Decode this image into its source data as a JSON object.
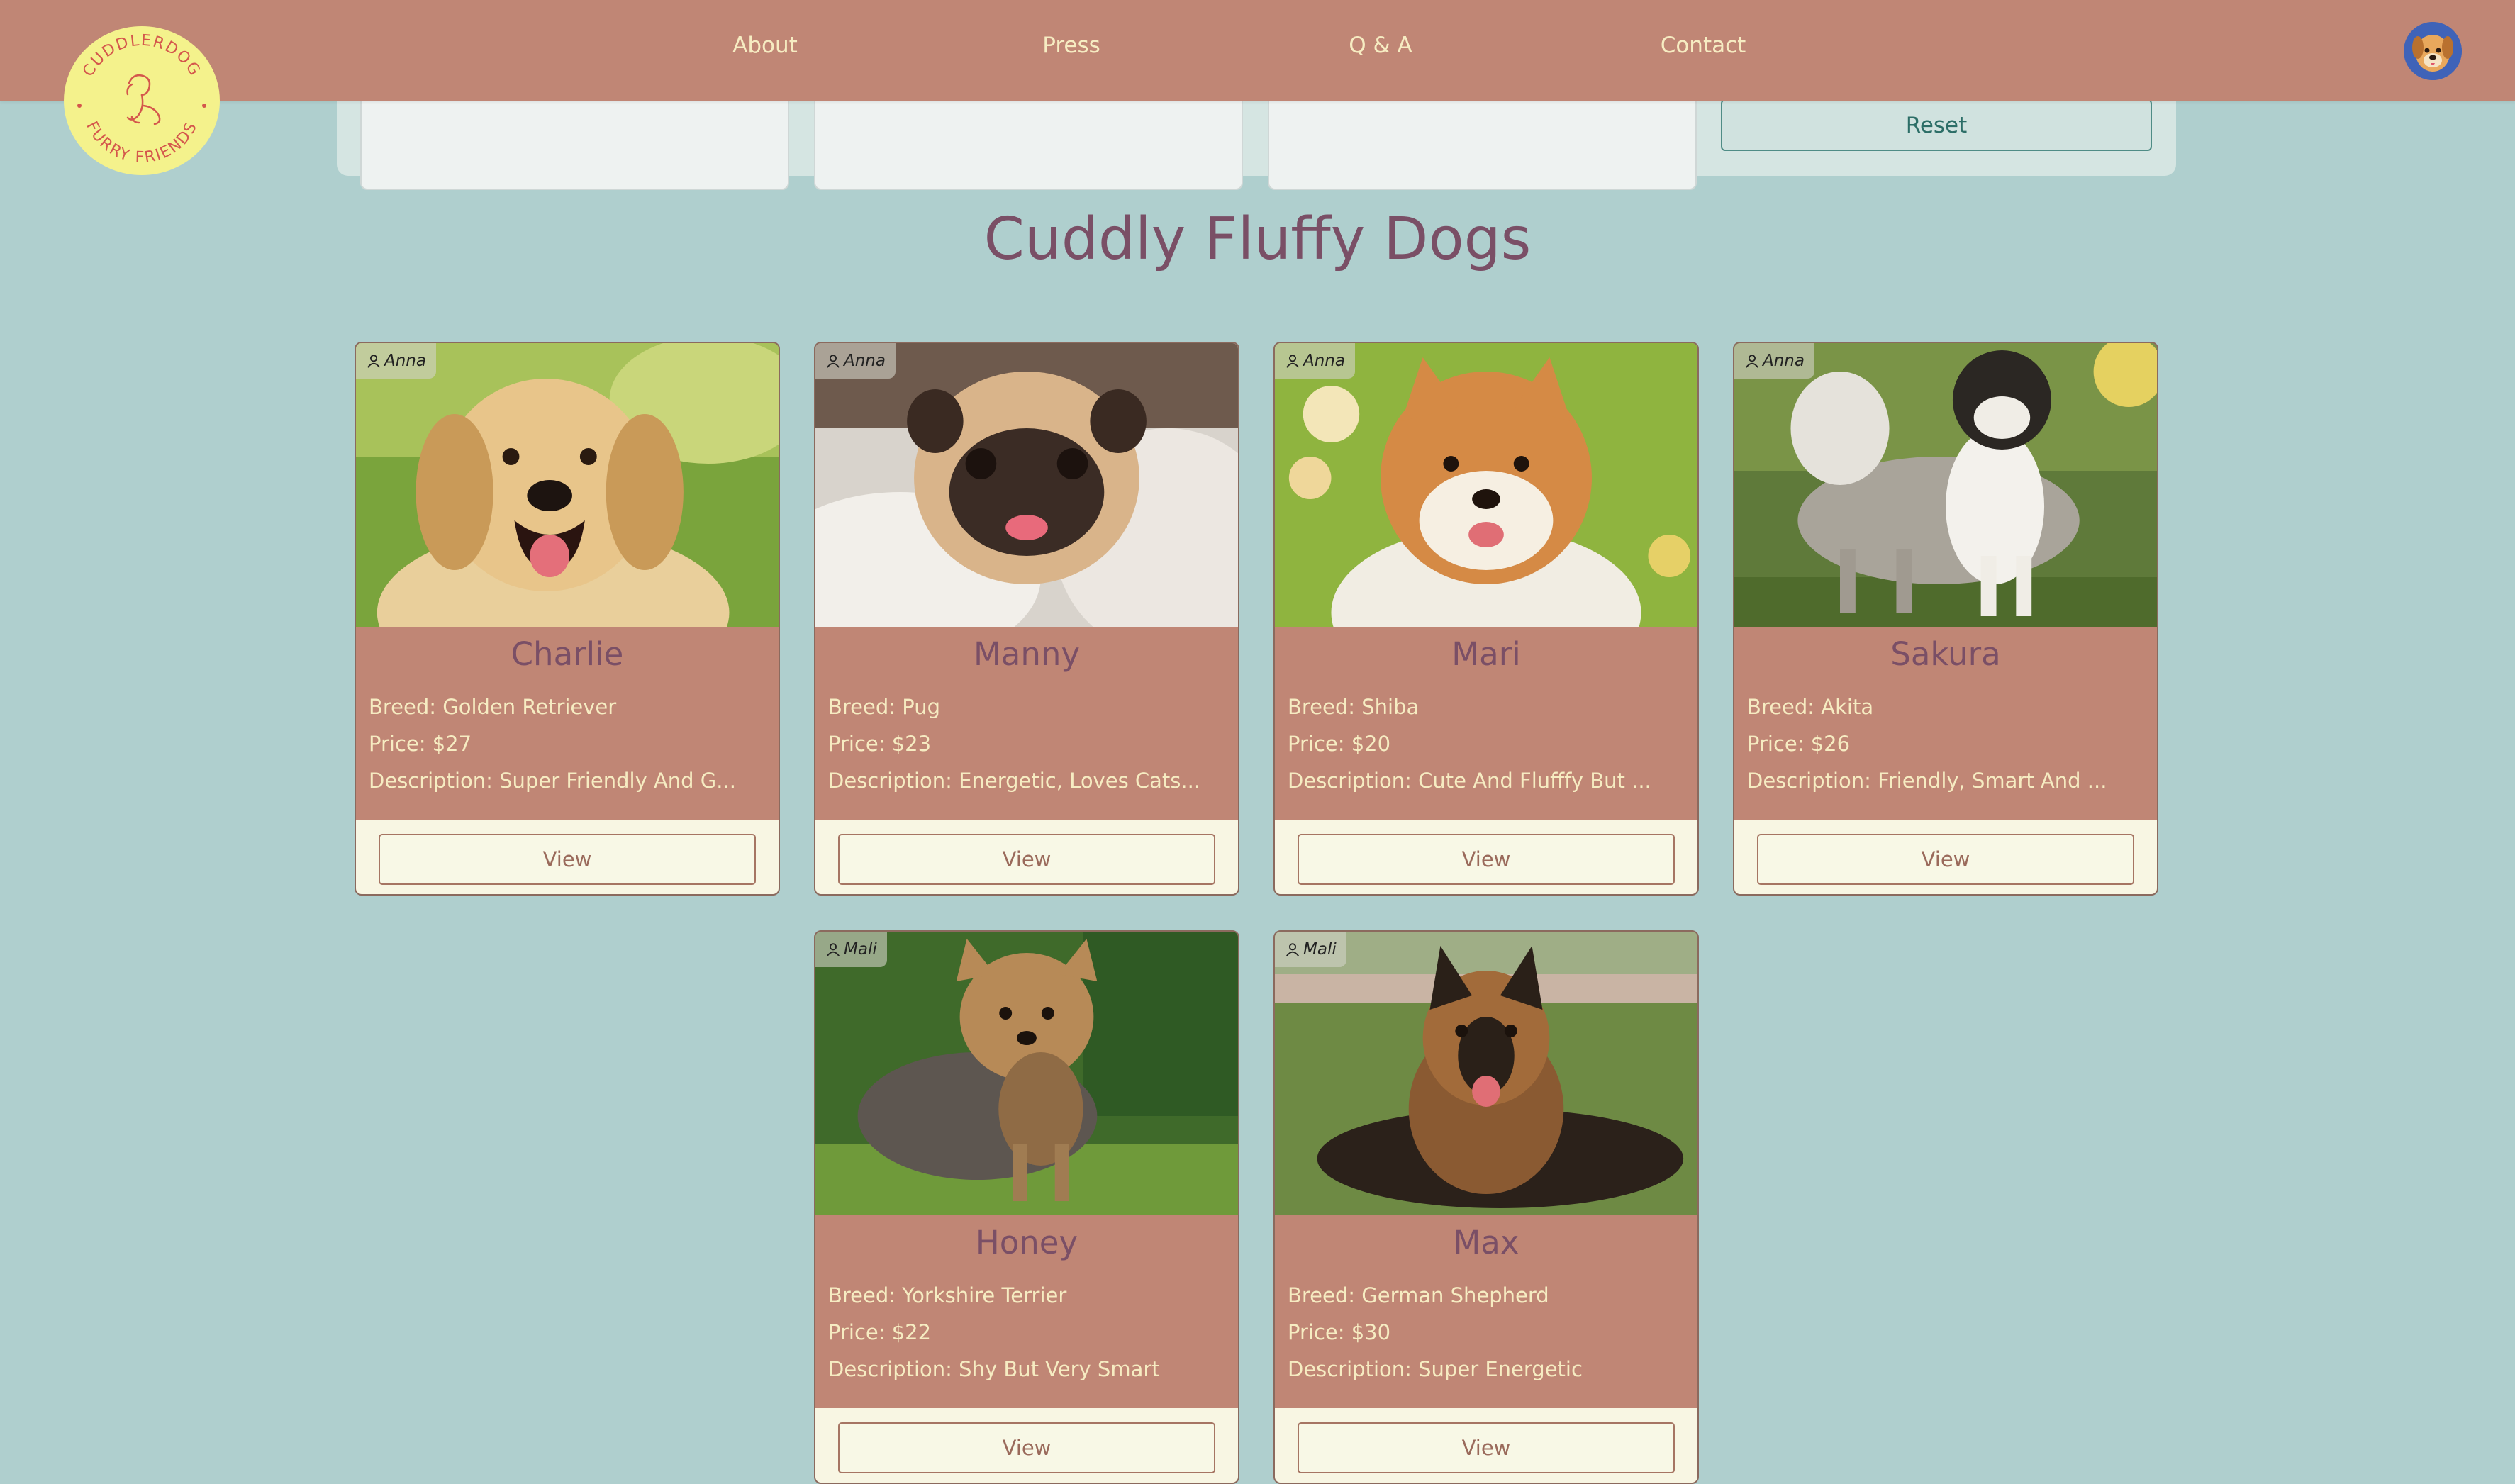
{
  "nav": {
    "links": [
      "About",
      "Press",
      "Q & A",
      "Contact"
    ],
    "logo": {
      "top_text": "CUDDLERDOG",
      "bottom_text": "FURRY FRIENDS",
      "icon": "dog-outline-icon"
    },
    "avatar_icon": "dog-face-avatar-icon"
  },
  "filters": {
    "fields": [
      "",
      "",
      ""
    ],
    "reset_label": "Reset"
  },
  "page_title": "Cuddly Fluffy Dogs",
  "colors": {
    "background": "#afcfce",
    "navbar": "#c08675",
    "title": "#7a4f66",
    "card_text": "#f6ecc2",
    "logo": "#f4f28c"
  },
  "dogs": [
    {
      "owner": "Anna",
      "name": "Charlie",
      "breed": "Breed: Golden Retriever",
      "price": "Price: $27",
      "description": "Description: Super Friendly And G...",
      "view_label": "View",
      "photo": "golden-retriever-photo"
    },
    {
      "owner": "Anna",
      "name": "Manny",
      "breed": "Breed: Pug",
      "price": "Price: $23",
      "description": "Description: Energetic, Loves Cats...",
      "view_label": "View",
      "photo": "pug-photo"
    },
    {
      "owner": "Anna",
      "name": "Mari",
      "breed": "Breed: Shiba",
      "price": "Price: $20",
      "description": "Description: Cute And Flufffy But ...",
      "view_label": "View",
      "photo": "shiba-photo"
    },
    {
      "owner": "Anna",
      "name": "Sakura",
      "breed": "Breed: Akita",
      "price": "Price: $26",
      "description": "Description: Friendly, Smart And ...",
      "view_label": "View",
      "photo": "akita-photo"
    },
    {
      "owner": "Mali",
      "name": "Honey",
      "breed": "Breed: Yorkshire Terrier",
      "price": "Price: $22",
      "description": "Description: Shy But Very Smart",
      "view_label": "View",
      "photo": "yorkshire-terrier-photo"
    },
    {
      "owner": "Mali",
      "name": "Max",
      "breed": "Breed: German Shepherd",
      "price": "Price: $30",
      "description": "Description: Super Energetic",
      "view_label": "View",
      "photo": "german-shepherd-photo"
    }
  ]
}
